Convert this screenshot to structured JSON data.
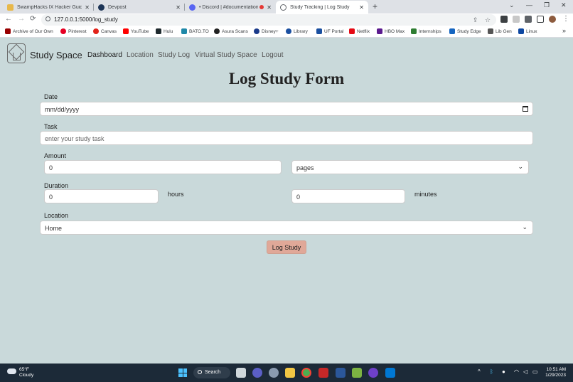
{
  "browser": {
    "tabs": [
      {
        "title": "SwampHacks IX Hacker Guide",
        "close": "✕",
        "favicon_color": "#e8b84a"
      },
      {
        "title": "Devpost",
        "close": "✕",
        "favicon_color": "#1d3557"
      },
      {
        "title": "• Discord | #documentation",
        "close": "✕",
        "favicon_color": "#5865f2"
      },
      {
        "title": "Study Tracking | Log Study",
        "close": "✕",
        "favicon_color": "#5f6368"
      }
    ],
    "new_tab": "+",
    "window_controls": {
      "chevron": "⌄",
      "minimize": "—",
      "maximize": "❐",
      "close": "✕"
    },
    "nav": {
      "back": "←",
      "forward": "→",
      "reload": "⟳"
    },
    "url": "127.0.0.1:5000/log_study",
    "bookmarks": [
      {
        "label": "Archive of Our Own",
        "color": "#990000"
      },
      {
        "label": "Pinterest",
        "color": "#e60023"
      },
      {
        "label": "Canvas",
        "color": "#e2231a"
      },
      {
        "label": "YouTube",
        "color": "#ff0000"
      },
      {
        "label": "Hulu",
        "color": "#1f2a2e"
      },
      {
        "label": "BATO.TO",
        "color": "#1e88a8"
      },
      {
        "label": "Asura Scans",
        "color": "#222222"
      },
      {
        "label": "Disney+",
        "color": "#1a3a8a"
      },
      {
        "label": "Library",
        "color": "#1a4fa0"
      },
      {
        "label": "UF Portal",
        "color": "#1a4fa0"
      },
      {
        "label": "Netflix",
        "color": "#e50914"
      },
      {
        "label": "HBO Max",
        "color": "#5b1a8e"
      },
      {
        "label": "Internships",
        "color": "#2e7d32"
      },
      {
        "label": "Study Edge",
        "color": "#1565c0"
      },
      {
        "label": "Lib Gen",
        "color": "#555555"
      },
      {
        "label": "Linux",
        "color": "#0d47a1"
      }
    ],
    "bookmarks_more": "»"
  },
  "navbar": {
    "brand": "Study Space",
    "links": [
      "Dashboard",
      "Location",
      "Study Log",
      "Virtual Study Space",
      "Logout"
    ]
  },
  "form": {
    "title": "Log Study Form",
    "date_label": "Date",
    "date_placeholder": "mm/dd/yyyy",
    "task_label": "Task",
    "task_placeholder": "enter your study task",
    "amount_label": "Amount",
    "amount_value": "0",
    "amount_unit_selected": "pages",
    "duration_label": "Duration",
    "hours_value": "0",
    "hours_unit": "hours",
    "minutes_value": "0",
    "minutes_unit": "minutes",
    "location_label": "Location",
    "location_selected": "Home",
    "submit_label": "Log Study"
  },
  "taskbar": {
    "weather_temp": "65°F",
    "weather_desc": "Cloudy",
    "search_label": "Search",
    "time": "10:51 AM",
    "date": "1/29/2023",
    "tray_chevron": "^"
  }
}
